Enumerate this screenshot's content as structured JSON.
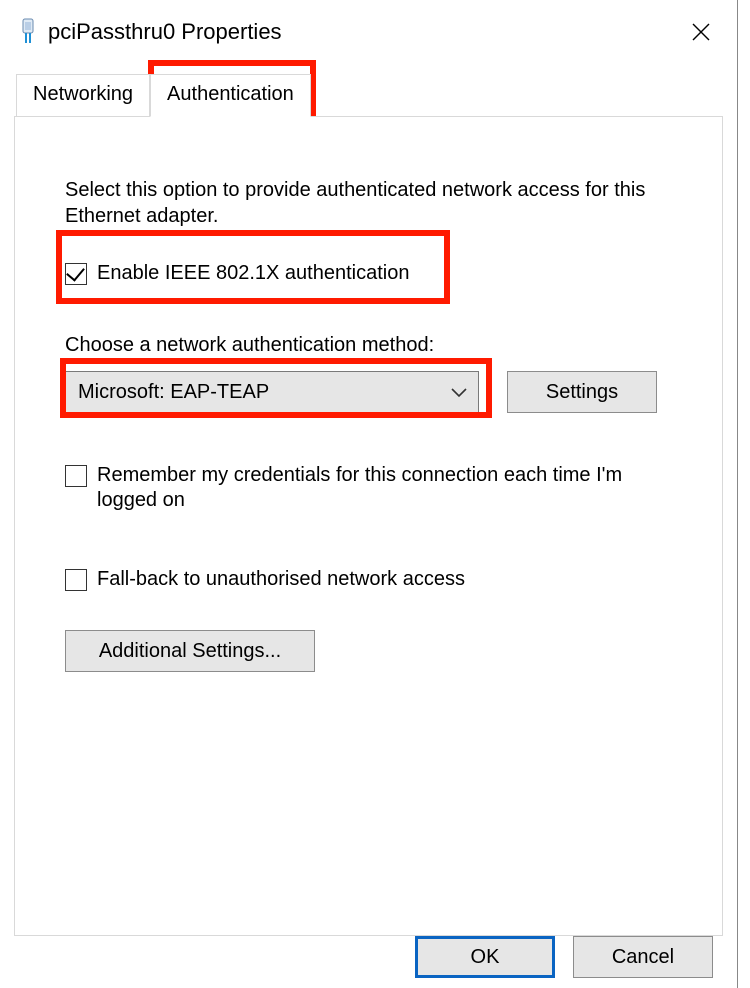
{
  "window": {
    "title": "pciPassthru0 Properties"
  },
  "tabs": {
    "networking": "Networking",
    "authentication": "Authentication"
  },
  "page": {
    "instruction": "Select this option to provide authenticated network access for this Ethernet adapter.",
    "enable_8021x_label": "Enable IEEE 802.1X authentication",
    "enable_8021x_checked": true,
    "method_label": "Choose a network authentication method:",
    "method_selected": "Microsoft: EAP-TEAP",
    "settings_button": "Settings",
    "remember_label": "Remember my credentials for this connection each time I'm logged on",
    "remember_checked": false,
    "fallback_label": "Fall-back to unauthorised network access",
    "fallback_checked": false,
    "additional_button": "Additional Settings..."
  },
  "footer": {
    "ok": "OK",
    "cancel": "Cancel"
  },
  "highlight_color": "#ff1a00"
}
